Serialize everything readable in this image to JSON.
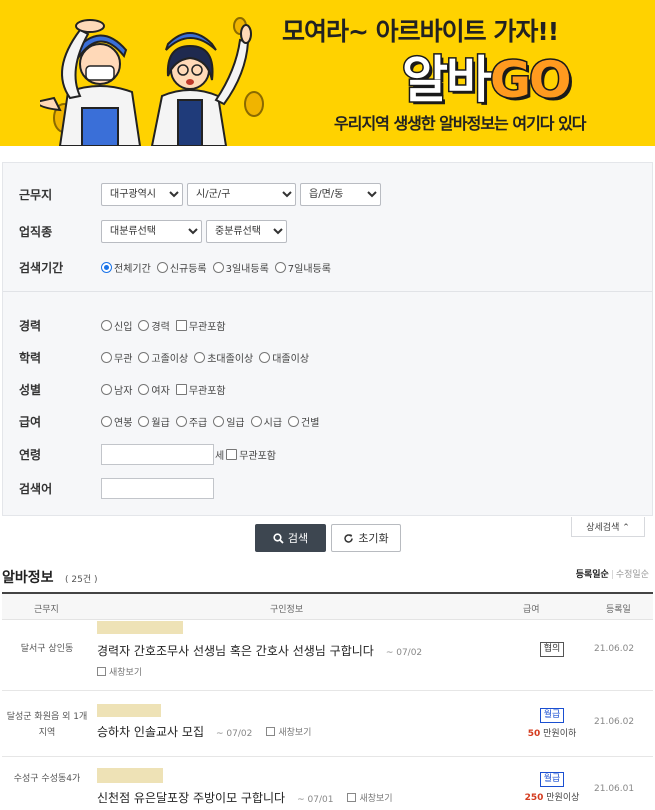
{
  "banner": {
    "title1": "모여라~ 아르바이트 가자!!",
    "title2_prefix": "알바",
    "title2_suffix": "GO",
    "subtitle": "우리지역 생생한 알바정보는 여기다 있다"
  },
  "search": {
    "location": {
      "label": "근무지",
      "selects": [
        "대구광역시",
        "시/군/구",
        "읍/면/동"
      ]
    },
    "category": {
      "label": "업직종",
      "selects": [
        "대분류선택",
        "중분류선택"
      ]
    },
    "period": {
      "label": "검색기간",
      "options": [
        "전체기간",
        "신규등록",
        "3일내등록",
        "7일내등록"
      ],
      "selected": "전체기간"
    },
    "career": {
      "label": "경력",
      "options": [
        "신입",
        "경력"
      ],
      "check": "무관포함"
    },
    "education": {
      "label": "학력",
      "options": [
        "무관",
        "고졸이상",
        "초대졸이상",
        "대졸이상"
      ]
    },
    "gender": {
      "label": "성별",
      "options": [
        "남자",
        "여자"
      ],
      "check": "무관포함"
    },
    "salary": {
      "label": "급여",
      "options": [
        "연봉",
        "월급",
        "주급",
        "일급",
        "시급",
        "건별"
      ]
    },
    "age": {
      "label": "연령",
      "unit": "세",
      "check": "무관포함",
      "value": ""
    },
    "keyword": {
      "label": "검색어",
      "value": ""
    },
    "search_button": "검색",
    "reset_button": "초기화",
    "detail_button": "상세검색 ⌃"
  },
  "results": {
    "title": "알바정보",
    "count": "( 25건 )",
    "sort_active": "등록일순",
    "sort_other": "수정일순",
    "columns": [
      "근무지",
      "구인정보",
      "급여",
      "등록일"
    ],
    "new_window_label": "새창보기",
    "rows": [
      {
        "area": "달서구 상인동",
        "title": "경력자 간호조무사 선생님 혹은 간호사 선생님 구합니다",
        "date": "~ 07/02",
        "pay_type": "협의",
        "pay_color": "gray",
        "pay_amount": "",
        "pay_unit": "",
        "reg_date": "21.06.02"
      },
      {
        "area": "달성군 화원읍 외 1개 지역",
        "title": "승하차 인솔교사 모집",
        "date": "~ 07/02",
        "pay_type": "월급",
        "pay_color": "blue",
        "pay_amount": "50",
        "pay_unit": "만원이하",
        "reg_date": "21.06.02"
      },
      {
        "area": "수성구 수성동4가",
        "title": "신천점 유은달포장 주방이모 구합니다",
        "date": "~ 07/01",
        "pay_type": "월급",
        "pay_color": "blue",
        "pay_amount": "250",
        "pay_unit": "만원이상",
        "reg_date": "21.06.01"
      }
    ]
  }
}
